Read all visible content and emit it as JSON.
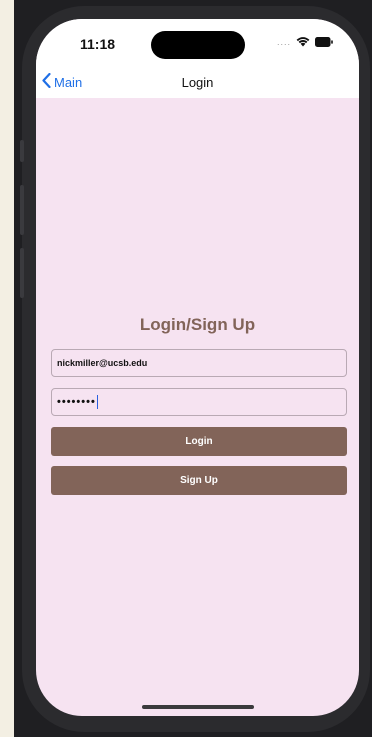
{
  "status_bar": {
    "time": "11:18",
    "signal": "....",
    "wifi_icon": "wifi-icon",
    "battery_icon": "battery-icon"
  },
  "nav_bar": {
    "back_label": "Main",
    "back_icon": "chevron-left-icon",
    "title": "Login"
  },
  "form": {
    "heading": "Login/Sign Up",
    "email_value": "nickmiller@ucsb.edu",
    "password_mask": "••••••••",
    "login_label": "Login",
    "signup_label": "Sign Up"
  },
  "colors": {
    "screen_bg": "#f6e3f1",
    "accent": "#826459",
    "link_blue": "#1f6fe6"
  }
}
